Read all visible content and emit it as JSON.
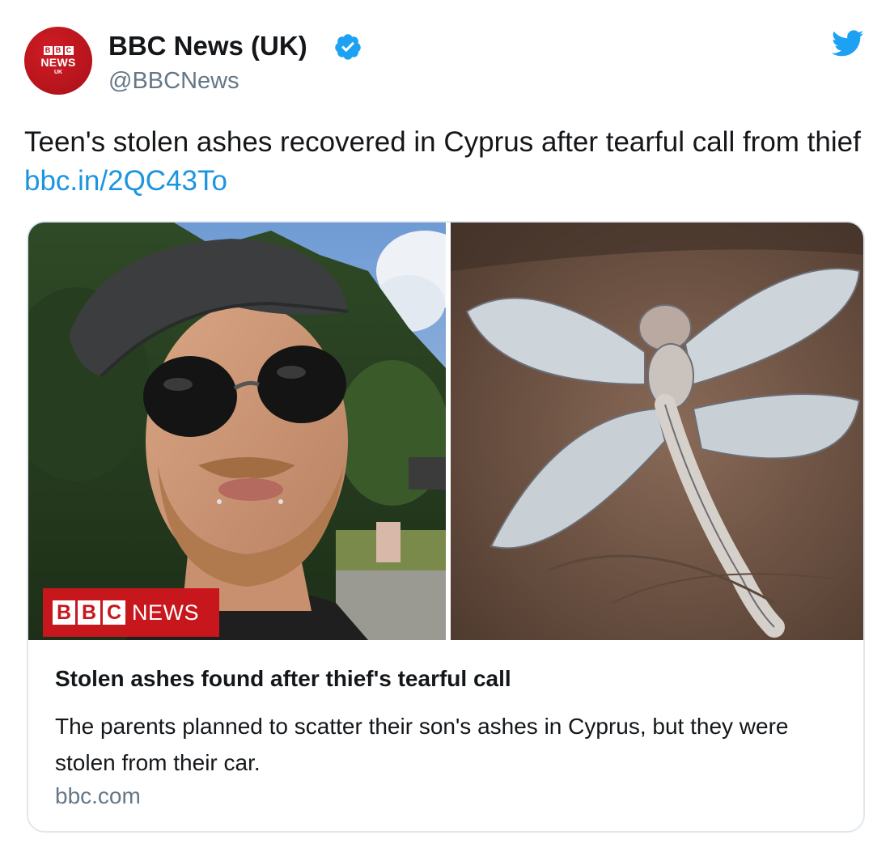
{
  "account": {
    "name": "BBC News (UK)",
    "handle": "@BBCNews",
    "avatar": {
      "top": "BBC",
      "middle": "NEWS",
      "bottom": "UK"
    },
    "verified": true
  },
  "tweet": {
    "text": "Teen's stolen ashes recovered in Cyprus after tearful call from thief ",
    "link": "bbc.in/2QC43To"
  },
  "card": {
    "watermark": {
      "letters": [
        "B",
        "B",
        "C"
      ],
      "word": "NEWS"
    },
    "title": "Stolen ashes found after thief's tearful call",
    "description": "The parents planned to scatter their son's ashes in Cyprus, but they were stolen from their car.",
    "domain": "bbc.com"
  },
  "icons": {
    "verified": "verified-badge-icon",
    "brand": "twitter-bird-icon"
  },
  "colors": {
    "link": "#1b95e0",
    "verified": "#1da1f2",
    "bbc_red": "#c8161d",
    "muted": "#657786"
  }
}
